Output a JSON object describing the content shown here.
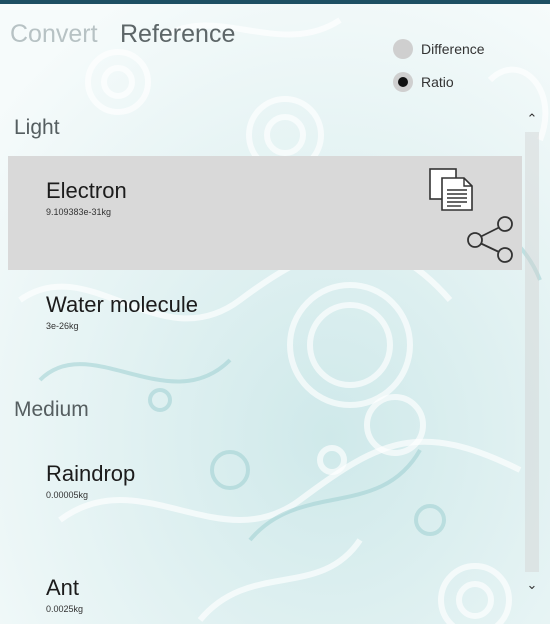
{
  "tabs": {
    "convert": "Convert",
    "reference": "Reference"
  },
  "mode": {
    "difference": "Difference",
    "ratio": "Ratio",
    "selected": "Ratio"
  },
  "sections": {
    "light": {
      "title": "Light",
      "items": [
        {
          "name": "Electron",
          "value": "9.109383e-31kg"
        },
        {
          "name": "Water molecule",
          "value": "3e-26kg"
        }
      ]
    },
    "medium": {
      "title": "Medium",
      "items": [
        {
          "name": "Raindrop",
          "value": "0.00005kg"
        },
        {
          "name": "Ant",
          "value": "0.0025kg"
        }
      ]
    }
  },
  "icons": {
    "copy": "copy-icon",
    "share": "share-icon",
    "scroll_up": "chevron-up-icon",
    "scroll_down": "chevron-down-icon"
  },
  "colors": {
    "accent_bar": "#1d4f63",
    "selected_row": "#d9d9d9",
    "background": "#f6fbfb",
    "swirl": "#a9d6d8"
  }
}
